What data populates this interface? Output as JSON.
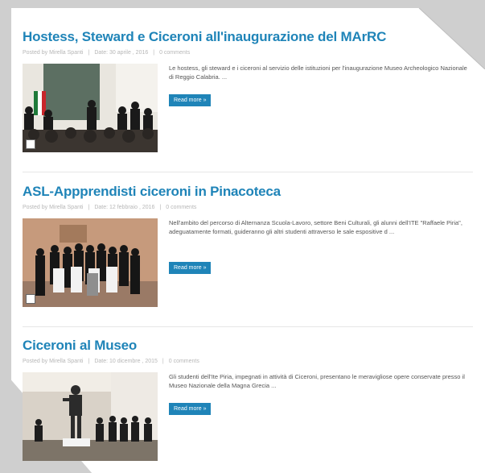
{
  "posts": [
    {
      "title": "Hostess, Steward e Ciceroni all'inaugurazione del MArRC",
      "author": "Posted by Mirella Spanti",
      "date": "Date: 30 aprile , 2016",
      "comments": "0 comments",
      "excerpt": "Le hostess, gli steward e i ciceroni al servizio delle istituzioni per l'inaugurazione Museo Archeologico Nazionale di Reggio Calabria. ...",
      "readmore": "Read more »"
    },
    {
      "title": "ASL-Appprendisti ciceroni in Pinacoteca",
      "author": "Posted by Mirella Spanti",
      "date": "Date: 12 febbraio , 2016",
      "comments": "0 comments",
      "excerpt": "Nell'ambito del percorso di Alternanza Scuola-Lavoro, settore Beni Culturali, gli alunni dell'ITE \"Raffaele Piria\", adeguatamente formati, guideranno gli altri studenti attraverso le sale espositive d ...",
      "readmore": "Read more »"
    },
    {
      "title": "Ciceroni al Museo",
      "author": "Posted by Mirella Spanti",
      "date": "Date: 10 dicembre , 2015",
      "comments": "0 comments",
      "excerpt": "Gli studenti dell'Ite Piria, impegnati in attività di Ciceroni, presentano le meravigliose opere conservate presso il Museo Nazionale della Magna Grecia ...",
      "readmore": "Read more »"
    }
  ],
  "colors": {
    "accent": "#1f84b8",
    "meta": "#b7b7b7",
    "text": "#555555"
  }
}
